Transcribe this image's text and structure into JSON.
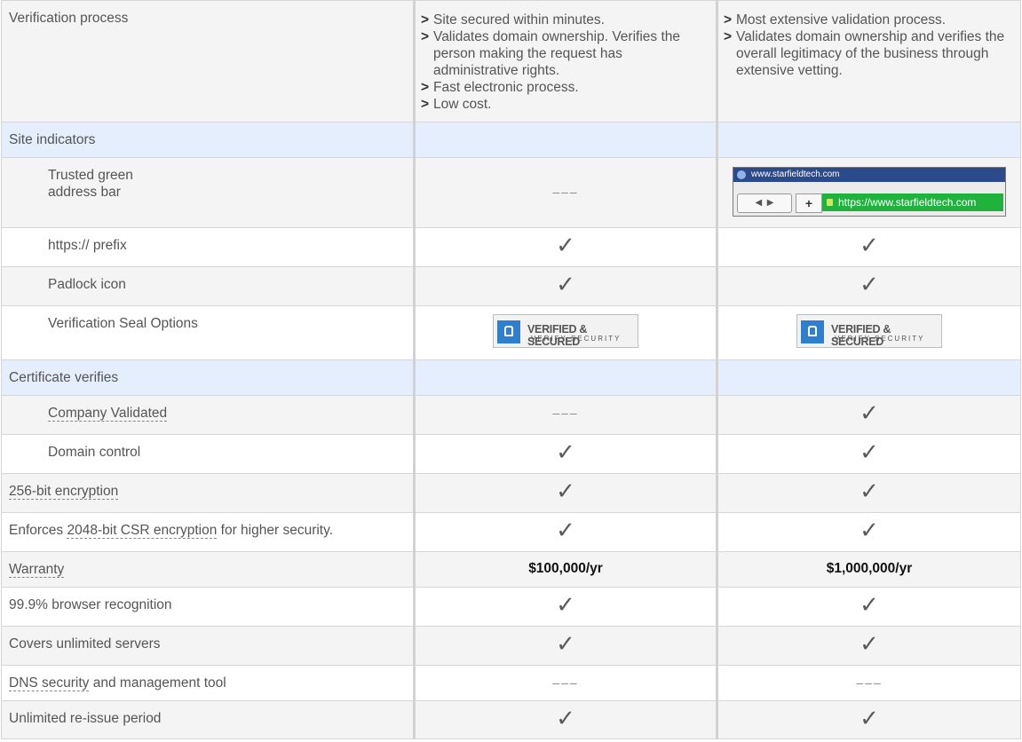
{
  "verification": {
    "label": "Verification process",
    "col1": [
      "Site secured within minutes.",
      "Validates domain ownership. Verifies the person making the request has administrative rights.",
      "Fast electronic process.",
      "Low cost."
    ],
    "col2": [
      "Most extensive validation process.",
      "Validates domain ownership and verifies the overall legitimacy of the business through extensive vetting."
    ]
  },
  "site_indicators": {
    "section_label": "Site indicators",
    "green_bar": {
      "label_line1": "Trusted green",
      "label_line2": "address bar",
      "col1": "–––",
      "browser_title": "www.starfieldtech.com",
      "browser_url": "https://www.starfieldtech.com",
      "nav_back": "◀",
      "nav_forward": "▶",
      "plus": "+"
    },
    "https": {
      "label": "https:// prefix"
    },
    "padlock": {
      "label": "Padlock icon"
    },
    "seal": {
      "label": "Verification Seal Options",
      "seal_line1": "VERIFIED & SECURED",
      "seal_line2": "VERIFY SECURITY"
    }
  },
  "cert_verifies": {
    "section_label": "Certificate verifies",
    "company": {
      "label": "Company Validated",
      "col1": "–––"
    },
    "domain": {
      "label": "Domain control"
    }
  },
  "features": {
    "encryption": {
      "label": "256-bit encryption"
    },
    "csr": {
      "pre": "Enforces ",
      "link": "2048-bit CSR encryption",
      "post": " for higher security."
    },
    "warranty": {
      "label": "Warranty",
      "col1": "$100,000/yr",
      "col2": "$1,000,000/yr"
    },
    "browser": {
      "label": "99.9% browser recognition"
    },
    "servers": {
      "label": "Covers unlimited servers"
    },
    "dns": {
      "link": "DNS security",
      "post": " and management tool",
      "col1": "–––",
      "col2": "–––"
    },
    "reissue": {
      "label": "Unlimited re-issue period"
    }
  },
  "check_glyph": "✓",
  "colors": {
    "section_bg": "#e4eefc",
    "green_bar": "#1fb33d",
    "seal_blue": "#2f7fd0"
  }
}
